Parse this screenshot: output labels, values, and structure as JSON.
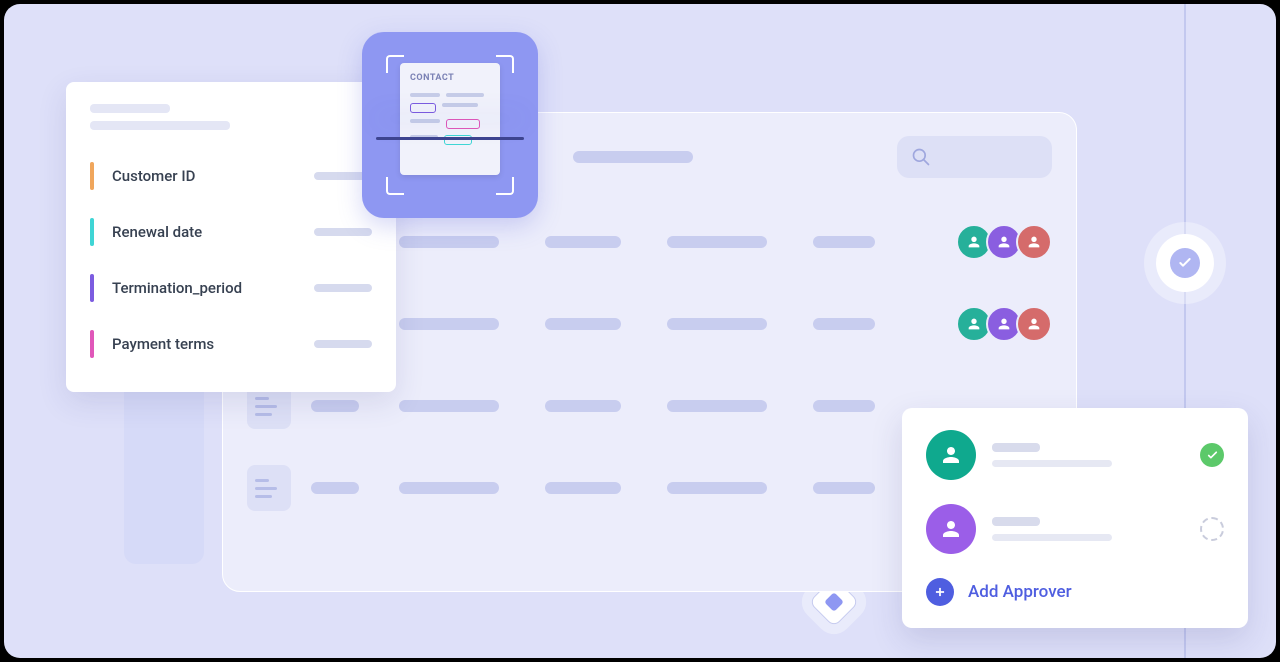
{
  "scanner": {
    "doc_label": "CONTACT"
  },
  "metadata": {
    "fields": [
      {
        "label": "Customer ID",
        "color": "orange"
      },
      {
        "label": "Renewal date",
        "color": "cyan"
      },
      {
        "label": "Termination_period",
        "color": "purple"
      },
      {
        "label": "Payment terms",
        "color": "pink"
      }
    ]
  },
  "approvers": {
    "add_label": "Add Approver"
  }
}
